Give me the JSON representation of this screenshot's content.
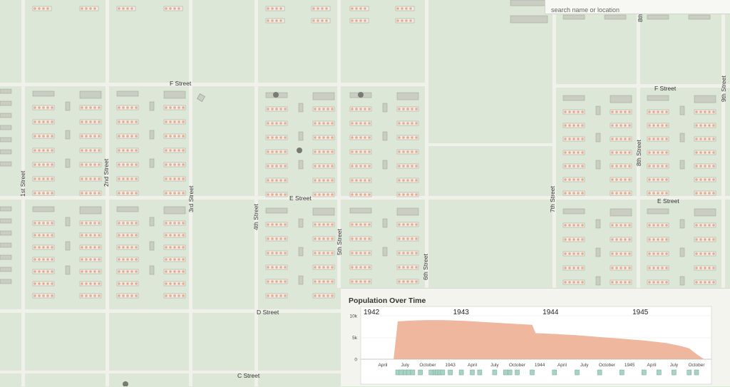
{
  "search": {
    "placeholder": "search name or location"
  },
  "streets": {
    "f_street": "F Street",
    "f_street_east": "F Street",
    "e_street": "E Street",
    "e_street_east": "E Street",
    "d_street": "D Street",
    "c_street": "C Street",
    "first": "1st Street",
    "second": "2nd Street",
    "third": "3rd Street",
    "fourth": "4th Street",
    "fifth": "5th Street",
    "sixth": "6th Street",
    "seventh": "7th Street",
    "eighth": "8th Street",
    "eighth_top": "8th",
    "ninth": "9th Street"
  },
  "colors": {
    "map_background": "#dce7d8",
    "road": "#f1f1ec",
    "building_gray": "#c9cdc2",
    "building_occupied": "#e9a98f",
    "population_fill": "#eeb79e",
    "event_marker": "#a9d2c3"
  },
  "population_panel": {
    "title": "Population Over Time",
    "year_labels": [
      "1942",
      "1943",
      "1944",
      "1945"
    ],
    "y_ticks": [
      "10k",
      "5k",
      "0"
    ],
    "x_ticks": [
      "April",
      "July",
      "October",
      "1943",
      "April",
      "July",
      "October",
      "1944",
      "April",
      "July",
      "October",
      "1945",
      "April",
      "July",
      "October"
    ]
  },
  "chart_data": {
    "type": "area",
    "title": "Population Over Time",
    "xlabel": "",
    "ylabel": "",
    "ylim": [
      0,
      10000
    ],
    "x": [
      "1942-03",
      "1942-04",
      "1942-05",
      "1942-05-15",
      "1942-06",
      "1942-08",
      "1942-10",
      "1942-12",
      "1943-03",
      "1943-06",
      "1943-09",
      "1943-12",
      "1943-12-15",
      "1944-03",
      "1944-06",
      "1944-09",
      "1944-12",
      "1945-03",
      "1945-06",
      "1945-08",
      "1945-09",
      "1945-10",
      "1945-11"
    ],
    "series": [
      {
        "values": [
          0,
          0,
          0,
          0,
          8700,
          8900,
          9000,
          9000,
          8800,
          8500,
          8200,
          7900,
          6000,
          5800,
          5500,
          5100,
          4700,
          4300,
          3700,
          3000,
          2500,
          1200,
          0
        ]
      }
    ],
    "event_markers": [
      "1942-06",
      "1942-06-15",
      "1942-07",
      "1942-07-15",
      "1942-08",
      "1942-09",
      "1942-10-15",
      "1942-11",
      "1942-11-10",
      "1942-11-20",
      "1942-12",
      "1943-01",
      "1943-02-15",
      "1943-04",
      "1943-05",
      "1943-07",
      "1943-08-15",
      "1943-09",
      "1943-10",
      "1943-12",
      "1944-03",
      "1944-06",
      "1944-09",
      "1944-12",
      "1945-03",
      "1945-05",
      "1945-07",
      "1945-09",
      "1945-10"
    ]
  }
}
